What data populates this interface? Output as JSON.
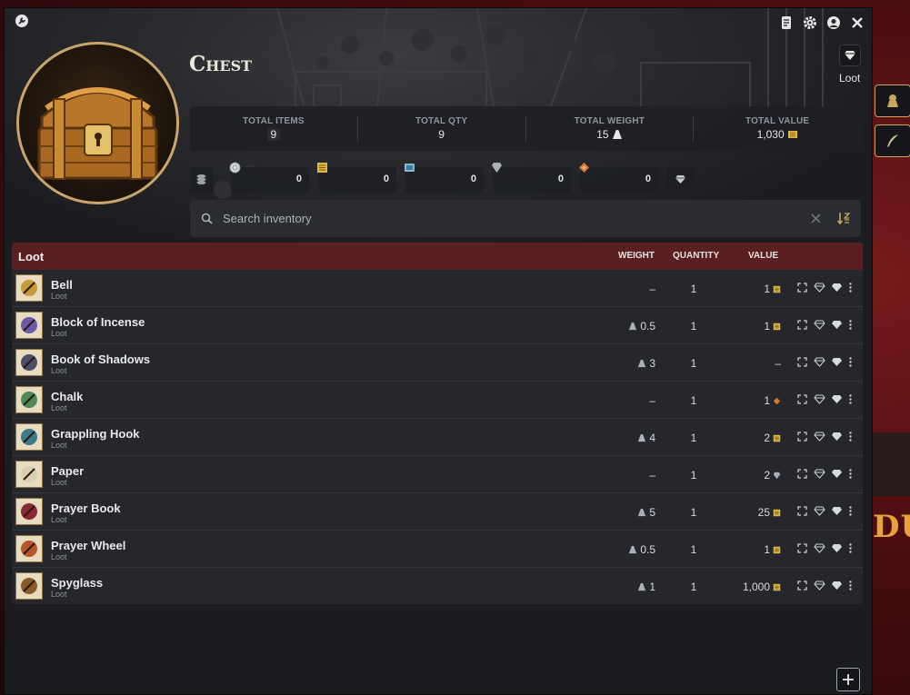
{
  "window": {
    "title": "Chest",
    "role_label": "Loot"
  },
  "stats": [
    {
      "label": "TOTAL ITEMS",
      "value": "9"
    },
    {
      "label": "TOTAL QTY",
      "value": "9"
    },
    {
      "label": "TOTAL WEIGHT",
      "value": "15"
    },
    {
      "label": "TOTAL VALUE",
      "value": "1,030"
    }
  ],
  "currencies": [
    {
      "icon": "platinum-coin-icon",
      "value": "0"
    },
    {
      "icon": "gold-ticket-icon",
      "value": "0"
    },
    {
      "icon": "blue-card-icon",
      "value": "0"
    },
    {
      "icon": "silver-gem-icon",
      "value": "0"
    },
    {
      "icon": "copper-diamond-icon",
      "value": "0"
    }
  ],
  "search": {
    "placeholder": "Search inventory"
  },
  "table": {
    "title": "Loot",
    "columns": {
      "weight": "WEIGHT",
      "quantity": "QUANTITY",
      "value": "VALUE"
    },
    "rows": [
      {
        "name": "Bell",
        "type": "Loot",
        "weight": "–",
        "qty": "1",
        "value": "1",
        "currency": "gold",
        "color": "#c79a3a"
      },
      {
        "name": "Block of Incense",
        "type": "Loot",
        "weight": "0.5",
        "qty": "1",
        "value": "1",
        "currency": "gold",
        "color": "#6a5aa8"
      },
      {
        "name": "Book of Shadows",
        "type": "Loot",
        "weight": "3",
        "qty": "1",
        "value": "–",
        "currency": "",
        "color": "#4a4f66"
      },
      {
        "name": "Chalk",
        "type": "Loot",
        "weight": "–",
        "qty": "1",
        "value": "1",
        "currency": "copper",
        "color": "#4f8a5a"
      },
      {
        "name": "Grappling Hook",
        "type": "Loot",
        "weight": "4",
        "qty": "1",
        "value": "2",
        "currency": "gold",
        "color": "#3c7a8a"
      },
      {
        "name": "Paper",
        "type": "Loot",
        "weight": "–",
        "qty": "1",
        "value": "2",
        "currency": "silver",
        "color": "#d9cfb3"
      },
      {
        "name": "Prayer Book",
        "type": "Loot",
        "weight": "5",
        "qty": "1",
        "value": "25",
        "currency": "gold",
        "color": "#8a2a36"
      },
      {
        "name": "Prayer Wheel",
        "type": "Loot",
        "weight": "0.5",
        "qty": "1",
        "value": "1",
        "currency": "gold",
        "color": "#b5562c"
      },
      {
        "name": "Spyglass",
        "type": "Loot",
        "weight": "1",
        "qty": "1",
        "value": "1,000",
        "currency": "gold",
        "color": "#8a5a2a"
      }
    ]
  },
  "edge_text": "DUN",
  "colors": {
    "header_bar": "#5b1f21",
    "gold": "#e0b640",
    "copper": "#d9792f",
    "silver": "#aab0b8",
    "accent": "#c9a560"
  }
}
